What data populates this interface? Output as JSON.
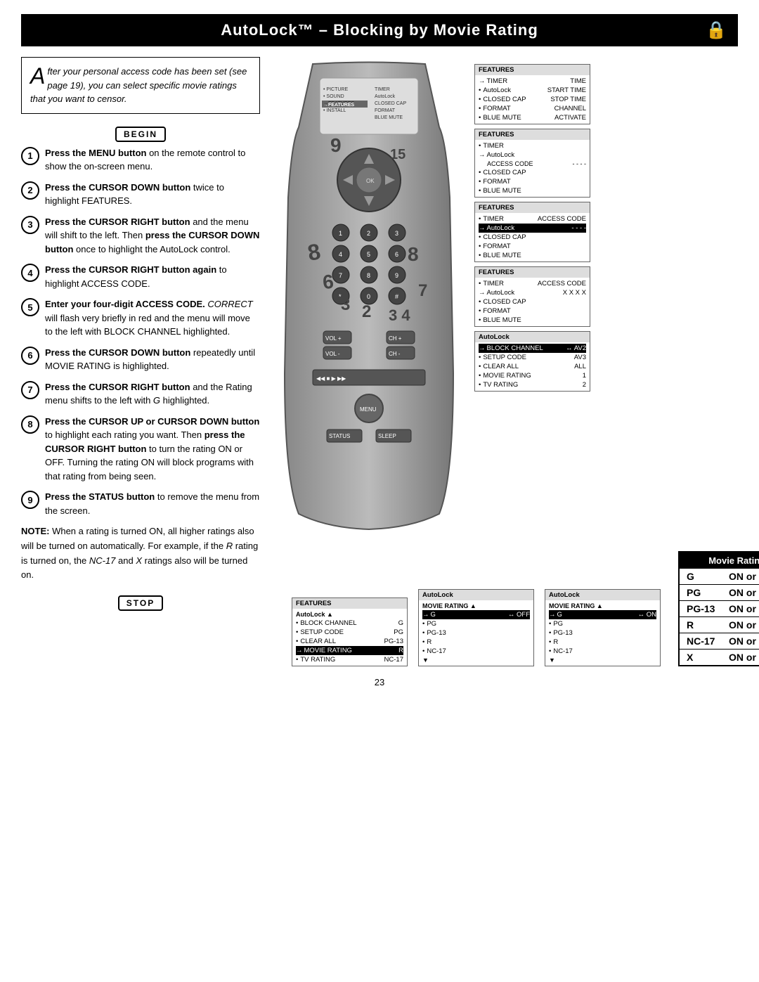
{
  "header": {
    "title": "AutoLock™ – Blocking by Movie Rating",
    "lock_icon": "🔒"
  },
  "intro": {
    "drop_cap": "A",
    "text": "fter your personal access code has been set (see page 19), you can select specific movie ratings that you want to censor."
  },
  "begin_badge": "BEGIN",
  "stop_badge": "STOP",
  "steps": [
    {
      "num": "1",
      "text": "Press the MENU button on the remote control to show the on-screen menu."
    },
    {
      "num": "2",
      "text": "Press the CURSOR DOWN button twice to highlight FEATURES."
    },
    {
      "num": "3",
      "text": "Press the CURSOR RIGHT button and the menu will shift to the left. Then press the CURSOR DOWN button once to highlight the AutoLock control."
    },
    {
      "num": "4",
      "text": "Press the CURSOR RIGHT button again to highlight ACCESS CODE."
    },
    {
      "num": "5",
      "text": "Enter your four-digit ACCESS CODE. CORRECT will flash very briefly in red and the menu will move to the left with BLOCK CHANNEL highlighted."
    },
    {
      "num": "6",
      "text": "Press the CURSOR DOWN button repeatedly until MOVIE RATING is highlighted."
    },
    {
      "num": "7",
      "text": "Press the CURSOR RIGHT button and the Rating menu shifts to the left with G highlighted."
    },
    {
      "num": "8",
      "text": "Press the CURSOR UP or CURSOR DOWN button to highlight each rating you want. Then press the CURSOR RIGHT button to turn the rating ON or OFF. Turning the rating ON will block programs with that rating from being seen."
    },
    {
      "num": "9",
      "text": "Press the STATUS button to remove the menu from the screen."
    }
  ],
  "note": {
    "label": "NOTE:",
    "text": "When a rating is turned ON, all higher ratings also will be turned on automatically. For example, if the R rating is turned on, the NC-17 and X ratings also will be turned on."
  },
  "menus": [
    {
      "id": "menu1",
      "header": "FEATURES",
      "items": [
        {
          "bullet": "→",
          "label": "TIMER",
          "right": "TIME",
          "active": false
        },
        {
          "bullet": "•",
          "label": "AutoLock",
          "right": "START TIME",
          "active": false
        },
        {
          "bullet": "•",
          "label": "CLOSED CAP",
          "right": "STOP TIME",
          "active": false
        },
        {
          "bullet": "•",
          "label": "FORMAT",
          "right": "CHANNEL",
          "active": false
        },
        {
          "bullet": "•",
          "label": "BLUE MUTE",
          "right": "ACTIVATE",
          "active": false
        }
      ]
    },
    {
      "id": "menu2",
      "header": "FEATURES",
      "items": [
        {
          "bullet": "•",
          "label": "TIMER",
          "right": "",
          "active": false
        },
        {
          "bullet": "→",
          "label": "AutoLock",
          "right": "ACCESS CODE",
          "active": false
        },
        {
          "bullet": "•",
          "label": "CLOSED CAP",
          "right": "- - - -",
          "active": false
        },
        {
          "bullet": "•",
          "label": "FORMAT",
          "right": "",
          "active": false
        },
        {
          "bullet": "•",
          "label": "BLUE MUTE",
          "right": "",
          "active": false
        }
      ]
    },
    {
      "id": "menu3",
      "header": "FEATURES",
      "items": [
        {
          "bullet": "•",
          "label": "TIMER",
          "right": "ACCESS CODE",
          "active": false
        },
        {
          "bullet": "→",
          "label": "AutoLock",
          "right": "- - - -",
          "active": true
        },
        {
          "bullet": "•",
          "label": "CLOSED CAP",
          "right": "",
          "active": false
        },
        {
          "bullet": "•",
          "label": "FORMAT",
          "right": "",
          "active": false
        },
        {
          "bullet": "•",
          "label": "BLUE MUTE",
          "right": "",
          "active": false
        }
      ]
    },
    {
      "id": "menu4",
      "header": "FEATURES",
      "items": [
        {
          "bullet": "•",
          "label": "TIMER",
          "right": "ACCESS CODE",
          "active": false
        },
        {
          "bullet": "→",
          "label": "AutoLock",
          "right": "X X X X",
          "active": false
        },
        {
          "bullet": "•",
          "label": "CLOSED CAP",
          "right": "",
          "active": false
        },
        {
          "bullet": "•",
          "label": "FORMAT",
          "right": "",
          "active": false
        },
        {
          "bullet": "•",
          "label": "BLUE MUTE",
          "right": "",
          "active": false
        }
      ]
    },
    {
      "id": "menu5",
      "header": "AutoLock",
      "items": [
        {
          "bullet": "→",
          "label": "BLOCK CHANNEL",
          "right": "AV2",
          "active": true
        },
        {
          "bullet": "•",
          "label": "SETUP CODE",
          "right": "AV3",
          "active": false
        },
        {
          "bullet": "•",
          "label": "CLEAR ALL",
          "right": "ALL",
          "active": false
        },
        {
          "bullet": "•",
          "label": "MOVIE RATING",
          "right": "1",
          "active": false
        },
        {
          "bullet": "•",
          "label": "TV RATING",
          "right": "2",
          "active": false
        }
      ]
    }
  ],
  "bottom_menus": [
    {
      "id": "bmenu1",
      "header": "FEATURES",
      "subheader": "AutoLock",
      "items": [
        {
          "bullet": "•",
          "label": "BLOCK CHANNEL",
          "right": "G"
        },
        {
          "bullet": "•",
          "label": "SETUP CODE",
          "right": "PG"
        },
        {
          "bullet": "•",
          "label": "CLEAR ALL",
          "right": "PG-13"
        },
        {
          "bullet": "→",
          "label": "MOVIE RATING",
          "right": "R",
          "active": true
        },
        {
          "bullet": "•",
          "label": "TV RATING",
          "right": "NC-17"
        }
      ]
    },
    {
      "id": "bmenu2",
      "header": "AutoLock",
      "subheader": "MOVIE RATING",
      "items": [
        {
          "bullet": "→",
          "label": "G",
          "right": "↔ OFF",
          "active": true
        },
        {
          "bullet": "•",
          "label": "PG",
          "right": ""
        },
        {
          "bullet": "•",
          "label": "PG-13",
          "right": ""
        },
        {
          "bullet": "•",
          "label": "R",
          "right": ""
        },
        {
          "bullet": "•",
          "label": "NC-17",
          "right": ""
        }
      ]
    }
  ],
  "last_menu": {
    "header": "AutoLock",
    "subheader": "MOVIE RATING",
    "items": [
      {
        "bullet": "→",
        "label": "G",
        "right": "↔ ON",
        "active": true
      },
      {
        "bullet": "•",
        "label": "PG",
        "right": ""
      },
      {
        "bullet": "•",
        "label": "PG-13",
        "right": ""
      },
      {
        "bullet": "•",
        "label": "R",
        "right": ""
      },
      {
        "bullet": "•",
        "label": "NC-17",
        "right": ""
      }
    ]
  },
  "rating_table": {
    "header": "Movie Rating Options",
    "rows": [
      {
        "code": "G",
        "value": "ON or OFF"
      },
      {
        "code": "PG",
        "value": "ON or OFF"
      },
      {
        "code": "PG-13",
        "value": "ON or OFF"
      },
      {
        "code": "R",
        "value": "ON or OFF"
      },
      {
        "code": "NC-17",
        "value": "ON or OFF"
      },
      {
        "code": "X",
        "value": "ON or OFF"
      }
    ]
  },
  "page_number": "23"
}
